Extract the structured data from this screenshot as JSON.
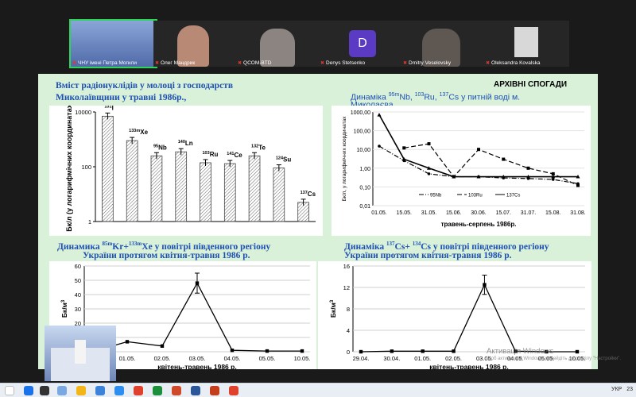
{
  "participants": [
    {
      "name": "ЧНУ імені Петра Могили",
      "active": true
    },
    {
      "name": "Олег Мандрик",
      "active": false
    },
    {
      "name": "QCOM-BTD",
      "active": false
    },
    {
      "name": "Denys Stetsenko",
      "active": false,
      "initial": "D"
    },
    {
      "name": "Dmitry Veselovsky",
      "active": false
    },
    {
      "name": "Oleksandra Kovalska",
      "active": false
    }
  ],
  "slide": {
    "archive": "АРХІВНІ СПОГАДИ",
    "chart1_title_l1": "Вміст радіонуклідів у молоці з господарств",
    "chart1_title_l2": "Миколаївщини у травні 1986р.,",
    "chart2_title_pre": "Динаміка ",
    "chart2_title_line2": "Миколаєва,",
    "chart3_title_pre": "Динамика ",
    "chart3_title_post": " у повітрі південного регіону",
    "chart3_title_l2": "України протягом квітня-травня 1986 р.",
    "chart4_title_pre": "Динаміка ",
    "chart4_title_post": " у повітрі південного регіону",
    "chart4_title_l2": "України протягом квітня-травня 1986 р."
  },
  "chart_data": [
    {
      "type": "bar",
      "ylabel": "Бк/л (у логарифмічних координатах)",
      "yscale": "log",
      "ylim": [
        1,
        10000
      ],
      "yticks": [
        "10000",
        "100",
        "1"
      ],
      "categories": [
        "131I",
        "133mXe",
        "95Nb",
        "140Ln",
        "103Ru",
        "141Ce",
        "132Te",
        "124Su",
        "137Cs"
      ],
      "labels": [
        {
          "sup": "131",
          "main": "I"
        },
        {
          "sup": "133m",
          "main": "Xe"
        },
        {
          "sup": "95",
          "main": "Nb"
        },
        {
          "sup": "140",
          "main": "Ln"
        },
        {
          "sup": "103",
          "main": "Ru"
        },
        {
          "sup": "141",
          "main": "Ce"
        },
        {
          "sup": "132",
          "main": "Te"
        },
        {
          "sup": "124",
          "main": "Su"
        },
        {
          "sup": "137",
          "main": "Cs"
        }
      ],
      "values": [
        7000,
        900,
        250,
        350,
        140,
        130,
        250,
        90,
        5
      ]
    },
    {
      "type": "line",
      "yscale": "log",
      "ylabel": "Бк/л, у логарифмічних координатах",
      "xlabel": "травень-серпень 1986р.",
      "title_isotopes": [
        {
          "sup": "95m",
          "main": "Nb"
        },
        {
          "sup": "103",
          "main": "Ru"
        },
        {
          "sup": "137",
          "main": "Cs"
        }
      ],
      "title_tail": " у питній воді м.",
      "yticks": [
        "1000,00",
        "100,00",
        "10,00",
        "1,00",
        "0,10",
        "0,01"
      ],
      "categories": [
        "01.05.",
        "15.05.",
        "31.05.",
        "15.06.",
        "30.06.",
        "15.07.",
        "31.07.",
        "15.08.",
        "31.08."
      ],
      "series": [
        {
          "name": "95Nb",
          "values": [
            15,
            2.5,
            0.5,
            0.35,
            0.35,
            0.3,
            0.28,
            0.25,
            0.15
          ]
        },
        {
          "name": "103Ru",
          "values": [
            null,
            12,
            20,
            0.35,
            10,
            3,
            1,
            0.5,
            0.12
          ]
        },
        {
          "name": "137Cs",
          "values": [
            700,
            3,
            1,
            0.35,
            0.35,
            0.35,
            0.35,
            0.35,
            0.35
          ]
        }
      ]
    },
    {
      "type": "line",
      "ylabel": "Бк/м",
      "ylabel_sup": "3",
      "xlabel": "квітень-травень 1986 р.",
      "title_isotopes": [
        {
          "sup": "85m",
          "main": "Kr"
        },
        {
          "sup": "133m",
          "main": "Xe"
        }
      ],
      "ylim": [
        0,
        60
      ],
      "yticks": [
        "60",
        "50",
        "40",
        "30",
        "20",
        "10",
        "0"
      ],
      "categories": [
        "30.04.",
        "01.05.",
        "02.05.",
        "03.05.",
        "04.05.",
        "05.05.",
        "10.05."
      ],
      "values": [
        0,
        7,
        4,
        48,
        1,
        0.5,
        0.5
      ]
    },
    {
      "type": "line",
      "ylabel": "Бк/м",
      "ylabel_sup": "3",
      "xlabel": "квітень-травень 1986 р.",
      "title_isotopes": [
        {
          "sup": "137",
          "main": "Cs"
        },
        {
          "sup": "134",
          "main": "Cs"
        }
      ],
      "ylim": [
        0,
        16
      ],
      "yticks": [
        "16",
        "12",
        "8",
        "4",
        "0"
      ],
      "categories": [
        "29.04.",
        "30.04.",
        "01.05.",
        "02.05.",
        "03.05.",
        "04.05.",
        "05.05.",
        "10.05."
      ],
      "values": [
        0,
        0.1,
        0.1,
        0.1,
        12.5,
        0.1,
        0,
        0
      ]
    }
  ],
  "watermark": {
    "title": "Активація Windows",
    "subtitle": "Щоб активувати Windows, перейдіть до розділу \"Настройки\"."
  },
  "tray": {
    "lang": "УКР",
    "time": "23"
  },
  "colors": {
    "slide_bg": "#d9f1d9",
    "title_blue": "#1e50b4",
    "active_tile": "#2fd45a"
  }
}
